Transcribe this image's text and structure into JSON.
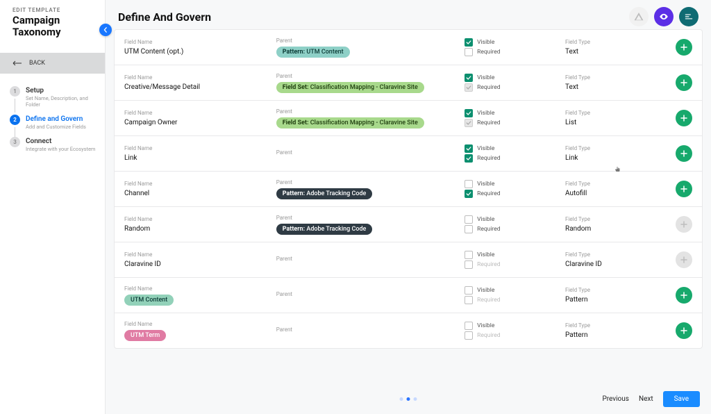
{
  "sidebar": {
    "kicker": "EDIT TEMPLATE",
    "title": "Campaign Taxonomy",
    "back": "BACK",
    "steps": [
      {
        "num": "1",
        "title": "Setup",
        "sub": "Set Name, Description, and Folder",
        "active": false
      },
      {
        "num": "2",
        "title": "Define and Govern",
        "sub": "Add and Customize Fields",
        "active": true
      },
      {
        "num": "3",
        "title": "Connect",
        "sub": "Integrate with your Ecosystem",
        "active": false
      }
    ]
  },
  "header": {
    "title": "Define And Govern"
  },
  "labels": {
    "field_name": "Field Name",
    "parent": "Parent",
    "field_type": "Field Type",
    "visible": "Visible",
    "required": "Required"
  },
  "rows": [
    {
      "name": "UTM Content (opt.)",
      "name_pill": null,
      "parent": {
        "prefix": "Pattern:",
        "value": "UTM Content",
        "style": "teal"
      },
      "visible": "on",
      "required": "off",
      "type": "Text",
      "add": true
    },
    {
      "name": "Creative/Message Detail",
      "name_pill": null,
      "parent": {
        "prefix": "Field Set:",
        "value": "Classification Mapping - Claravine Site",
        "style": "green"
      },
      "visible": "on",
      "required": "dis-on",
      "type": "Text",
      "add": true
    },
    {
      "name": "Campaign Owner",
      "name_pill": null,
      "parent": {
        "prefix": "Field Set:",
        "value": "Classification Mapping - Claravine Site",
        "style": "green"
      },
      "visible": "on",
      "required": "dis-on",
      "type": "List",
      "add": true
    },
    {
      "name": "Link",
      "name_pill": null,
      "parent": null,
      "visible": "on",
      "required": "on",
      "type": "Link",
      "add": true,
      "cursor": true
    },
    {
      "name": "Channel",
      "name_pill": null,
      "parent": {
        "prefix": "Pattern:",
        "value": "Adobe Tracking Code",
        "style": "dark"
      },
      "visible": "off",
      "required": "on",
      "type": "Autofill",
      "add": true
    },
    {
      "name": "Random",
      "name_pill": null,
      "parent": {
        "prefix": "Pattern:",
        "value": "Adobe Tracking Code",
        "style": "dark"
      },
      "visible": "off",
      "required": "off",
      "type": "Random",
      "add": false
    },
    {
      "name": "Claravine ID",
      "name_pill": null,
      "parent": null,
      "visible": "off",
      "required": "mut",
      "type": "Claravine ID",
      "add": false
    },
    {
      "name": null,
      "name_pill": {
        "text": "UTM Content",
        "style": "mint"
      },
      "parent": null,
      "visible": "off",
      "required": "mut",
      "type": "Pattern",
      "add": true
    },
    {
      "name": null,
      "name_pill": {
        "text": "UTM Term",
        "style": "pink"
      },
      "parent": null,
      "visible": "off",
      "required": "mut",
      "type": "Pattern",
      "add": true
    }
  ],
  "footer": {
    "page_count": 3,
    "active_page": 1,
    "previous": "Previous",
    "next": "Next",
    "save": "Save"
  }
}
